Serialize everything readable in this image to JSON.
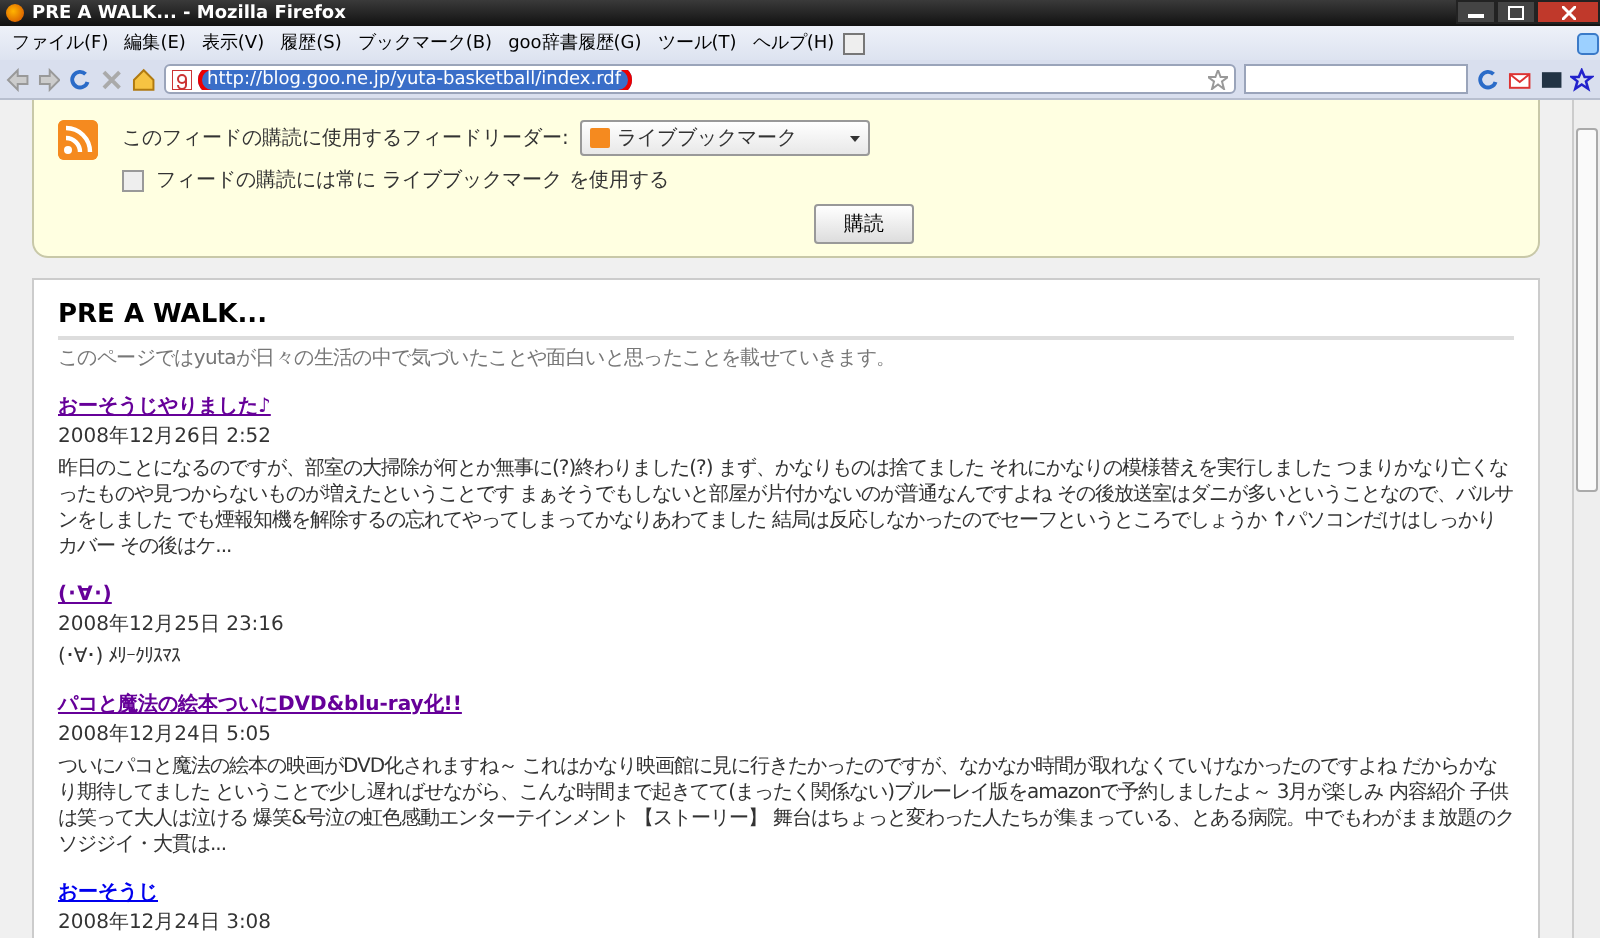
{
  "window": {
    "title": "PRE A WALK... - Mozilla Firefox"
  },
  "menu": [
    "ファイル(F)",
    "編集(E)",
    "表示(V)",
    "履歴(S)",
    "ブックマーク(B)",
    "goo辞書履歴(G)",
    "ツール(T)",
    "ヘルプ(H)"
  ],
  "address_bar": {
    "value": "http://blog.goo.ne.jp/yuta-basketball/index.rdf",
    "highlighted": true
  },
  "feed_box": {
    "reader_label": "このフィードの購読に使用するフィードリーダー:",
    "reader_value": "ライブブックマーク",
    "always_use": {
      "label": "フィードの購読には常に ライブブックマーク を使用する",
      "checked": false
    },
    "subscribe_button": "購読"
  },
  "blog": {
    "title": "PRE A WALK...",
    "description": "このページではyutaが日々の生活の中で気づいたことや面白いと思ったことを載せていきます。",
    "entries": [
      {
        "title": "おーそうじやりました♪",
        "visited": true,
        "date": "2008年12月26日 2:52",
        "summary": "昨日のことになるのですが、部室の大掃除が何とか無事に(?)終わりました(?) まず、かなりものは捨てました それにかなりの模様替えを実行しました つまりかなり亡くなったものや見つからないものが増えたということです まぁそうでもしないと部屋が片付かないのが普通なんですよね その後放送室はダニが多いということなので、バルサンをしました でも煙報知機を解除するの忘れてやってしまってかなりあわてました 結局は反応しなかったのでセーフというところでしょうか ↑パソコンだけはしっかりカバー その後はケ..."
      },
      {
        "title": "(･∀･)",
        "visited": true,
        "date": "2008年12月25日 23:16",
        "summary": "(･∀･) ﾒﾘｰｸﾘｽﾏｽ"
      },
      {
        "title": "パコと魔法の絵本ついにDVD&blu-ray化!!",
        "visited": true,
        "date": "2008年12月24日 5:05",
        "summary": "ついにパコと魔法の絵本の映画がDVD化されますね～ これはかなり映画館に見に行きたかったのですが、なかなか時間が取れなくていけなかったのですよね だからかなり期待してました ということで少し遅ればせながら、こんな時間まで起きてて(まったく関係ない)ブルーレイ版をamazonで予約しましたよ～ 3月が楽しみ 内容紹介 子供は笑って大人は泣ける 爆笑&号泣の虹色感動エンターテインメント 【ストーリー】 舞台はちょっと変わった人たちが集まっている、とある病院。中でもわがまま放題のクソジジイ・大貫は..."
      },
      {
        "title": "おーそうじ",
        "visited": false,
        "date": "2008年12月24日 3:08"
      }
    ]
  }
}
